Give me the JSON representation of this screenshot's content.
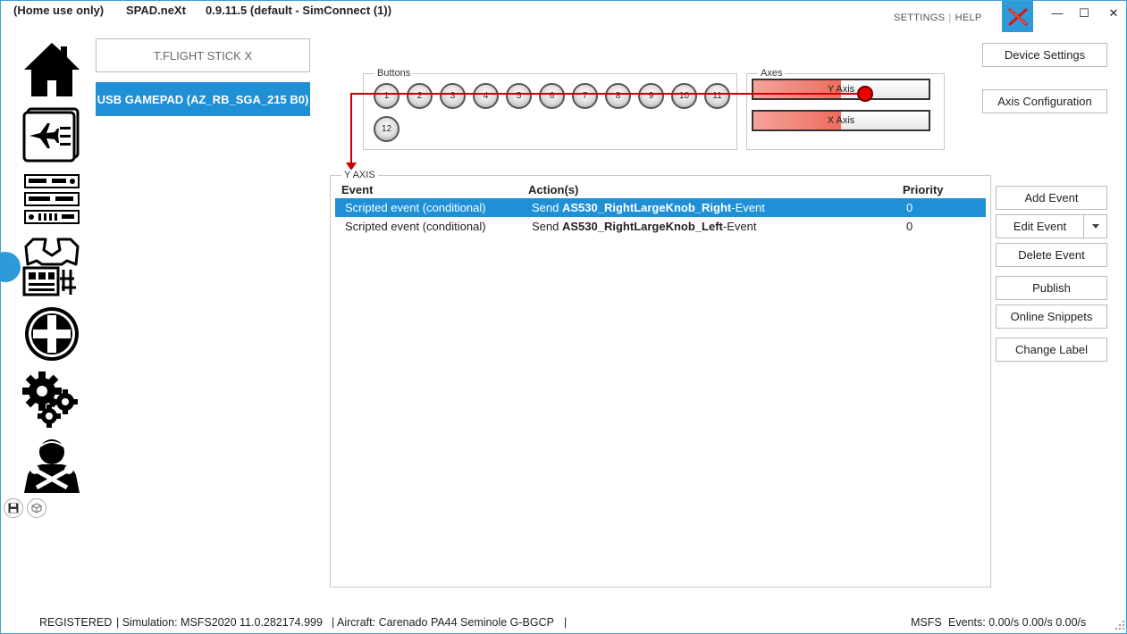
{
  "title": {
    "edition": "(Home use only)",
    "app_name": "SPAD.neXt",
    "version": "0.9.11.5 (default - SimConnect (1))"
  },
  "top_links": {
    "settings": "SETTINGS",
    "help": "HELP"
  },
  "window_controls": {
    "minimize": "—",
    "maximize": "☐",
    "close": "✕"
  },
  "devices": [
    {
      "label": "T.FLIGHT STICK X",
      "selected": false
    },
    {
      "label": "USB GAMEPAD (AZ_RB_SGA_215 B0)",
      "selected": true
    }
  ],
  "buttons_group": {
    "label": "Buttons",
    "buttons": [
      "1",
      "2",
      "3",
      "4",
      "5",
      "6",
      "7",
      "8",
      "9",
      "10",
      "11",
      "12"
    ]
  },
  "axes_group": {
    "label": "Axes",
    "axes": [
      {
        "label": "Y Axis",
        "value_percent": 50
      },
      {
        "label": "X Axis",
        "value_percent": 50
      }
    ]
  },
  "event_panel": {
    "label": "Y AXIS",
    "columns": {
      "event": "Event",
      "actions": "Action(s)",
      "priority": "Priority"
    },
    "rows": [
      {
        "event": "Scripted event (conditional)",
        "action_prefix": "Send",
        "action_name": "AS530_RightLargeKnob_Right",
        "action_suffix": "-Event",
        "priority": "0",
        "selected": true
      },
      {
        "event": "Scripted event (conditional)",
        "action_prefix": "Send",
        "action_name": "AS530_RightLargeKnob_Left",
        "action_suffix": "-Event",
        "priority": "0",
        "selected": false
      }
    ]
  },
  "right_panel": {
    "device_settings": "Device Settings",
    "axis_configuration": "Axis Configuration",
    "add_event": "Add Event",
    "edit_event": "Edit Event",
    "delete_event": "Delete Event",
    "publish": "Publish",
    "online_snippets": "Online Snippets",
    "change_label": "Change Label"
  },
  "status_bar": {
    "registered": "REGISTERED",
    "simulation": "| Simulation: MSFS2020 11.0.282174.999",
    "aircraft": "| Aircraft: Carenado PA44 Seminole G-BGCP",
    "aircraft_end": "|",
    "sim": "MSFS",
    "events": "Events: 0.00/s 0.00/s 0.00/s"
  },
  "colors": {
    "accent": "#1f8fd6",
    "connector": "#cc0000",
    "axis_fill": "#ef6b5e"
  },
  "icons": {
    "nav": [
      "home-icon",
      "flight-plan-icon",
      "radio-panels-icon",
      "devices-icon",
      "add-icon",
      "settings-gears-icon",
      "pilot-tools-icon"
    ],
    "bottom": [
      "save-icon",
      "package-icon"
    ],
    "logo": "spad-logo-icon"
  }
}
